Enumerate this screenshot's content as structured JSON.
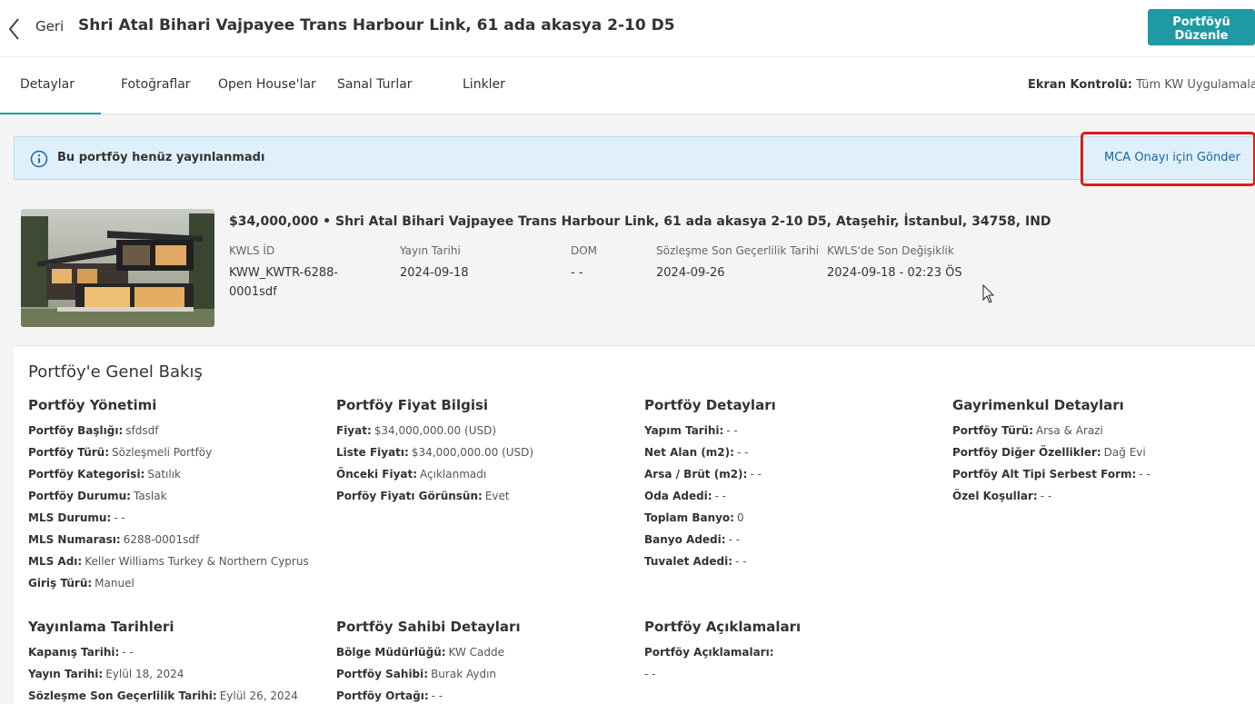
{
  "header": {
    "back_label": "Geri",
    "title": "Shri Atal Bihari Vajpayee Trans Harbour Link, 61 ada akasya 2-10 D5",
    "edit_button": "Portföyü\nDüzenle"
  },
  "tabs": [
    {
      "label": "Detaylar",
      "active": true
    },
    {
      "label": "Fotoğraflar"
    },
    {
      "label": "Open House'lar"
    },
    {
      "label": "Sanal Turlar"
    },
    {
      "label": "Linkler"
    }
  ],
  "screen_control": {
    "label": "Ekran Kontrolü:",
    "value": "Tüm KW Uygulamaları"
  },
  "banner": {
    "message": "Bu portföy henüz yayınlanmadı",
    "action": "MCA Onayı için Gönder"
  },
  "listing": {
    "headline": "$34,000,000 • Shri Atal Bihari Vajpayee Trans Harbour Link, 61 ada akasya 2-10 D5, Ataşehir, İstanbul, 34758, IND",
    "meta": [
      {
        "label": "KWLS İD",
        "value": "KWW_KWTR-6288-0001sdf"
      },
      {
        "label": "Yayın Tarihi",
        "value": "2024-09-18"
      },
      {
        "label": "DOM",
        "value": "- -"
      },
      {
        "label": "Sözleşme Son Geçerlilik Tarihi",
        "value": "2024-09-26"
      },
      {
        "label": "KWLS'de Son Değişiklik",
        "value": "2024-09-18 - 02:23 ÖS"
      }
    ]
  },
  "overview": {
    "title": "Portföy'e Genel Bakış",
    "sections": [
      {
        "title": "Portföy Yönetimi",
        "rows": [
          {
            "k": "Portföy Başlığı:",
            "v": "sfdsdf"
          },
          {
            "k": "Portföy Türü:",
            "v": "Sözleşmeli Portföy"
          },
          {
            "k": "Portföy Kategorisi:",
            "v": "Satılık"
          },
          {
            "k": "Portföy Durumu:",
            "v": "Taslak"
          },
          {
            "k": "MLS Durumu:",
            "v": "- -"
          },
          {
            "k": "MLS Numarası:",
            "v": "6288-0001sdf"
          },
          {
            "k": "MLS Adı:",
            "v": "Keller Williams Turkey & Northern Cyprus"
          },
          {
            "k": "Giriş Türü:",
            "v": "Manuel"
          }
        ]
      },
      {
        "title": "Portföy Fiyat Bilgisi",
        "rows": [
          {
            "k": "Fiyat:",
            "v": "$34,000,000.00 (USD)"
          },
          {
            "k": "Liste Fiyatı:",
            "v": "$34,000,000.00 (USD)"
          },
          {
            "k": "Önceki Fiyat:",
            "v": "Açıklanmadı"
          },
          {
            "k": "Porföy Fiyatı Görünsün:",
            "v": "Evet"
          }
        ]
      },
      {
        "title": "Portföy Detayları",
        "rows": [
          {
            "k": "Yapım Tarihi:",
            "v": "- -"
          },
          {
            "k": "Net Alan (m2):",
            "v": "- -"
          },
          {
            "k": "Arsa / Brüt (m2):",
            "v": "- -"
          },
          {
            "k": "Oda Adedi:",
            "v": "- -"
          },
          {
            "k": "Toplam Banyo:",
            "v": "0"
          },
          {
            "k": "Banyo Adedi:",
            "v": "- -"
          },
          {
            "k": "Tuvalet Adedi:",
            "v": "- -"
          }
        ]
      },
      {
        "title": "Gayrimenkul Detayları",
        "rows": [
          {
            "k": "Portföy Türü:",
            "v": "Arsa & Arazi"
          },
          {
            "k": "Portföy Diğer Özellikler:",
            "v": "Dağ Evi"
          },
          {
            "k": "Portföy Alt Tipi Serbest Form:",
            "v": "- -"
          },
          {
            "k": "Özel Koşullar:",
            "v": "- -"
          }
        ]
      },
      {
        "title": "Yayınlama Tarihleri",
        "rows": [
          {
            "k": "Kapanış Tarihi:",
            "v": "- -"
          },
          {
            "k": "Yayın Tarihi:",
            "v": "Eylül 18, 2024"
          },
          {
            "k": "Sözleşme Son Geçerlilik Tarihi:",
            "v": "Eylül 26, 2024"
          }
        ]
      },
      {
        "title": "Portföy Sahibi Detayları",
        "rows": [
          {
            "k": "Bölge Müdürlüğü:",
            "v": "KW Cadde"
          },
          {
            "k": "Portföy Sahibi:",
            "v": "Burak Aydın"
          },
          {
            "k": "Portföy Ortağı:",
            "v": "- -"
          }
        ]
      },
      {
        "title": "Portföy Açıklamaları",
        "rows": [
          {
            "k": "Portföy Açıklamaları:",
            "v": ""
          },
          {
            "k": "",
            "v": "- -"
          }
        ]
      }
    ]
  },
  "colors": {
    "accent": "#1f9aa5",
    "banner_bg": "#dff0fb",
    "highlight": "#dd1c1c",
    "link": "#1667a5"
  }
}
